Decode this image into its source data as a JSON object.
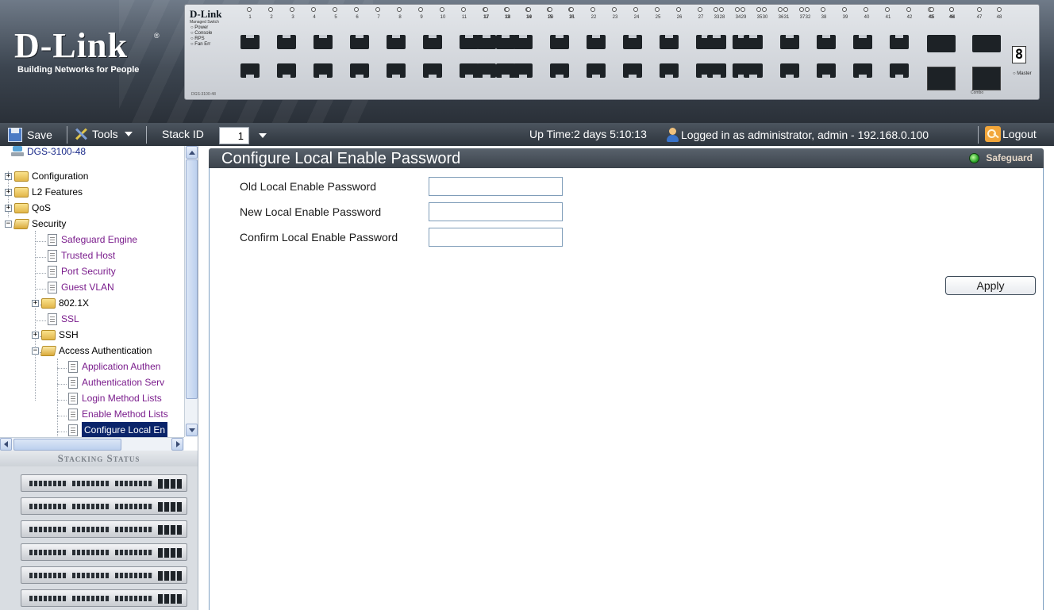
{
  "brand": {
    "logo": "D-Link",
    "tagline": "Building Networks for People"
  },
  "device_panel": {
    "brand": "D-Link",
    "subtitle": "Managed Switch",
    "model": "DGS-3100-48",
    "leds": [
      "Power",
      "Console",
      "RPS",
      "Fan Err"
    ],
    "port_numbers": [
      "1",
      "2",
      "3",
      "4",
      "5",
      "6",
      "7",
      "8",
      "9",
      "10",
      "11",
      "12",
      "13",
      "14",
      "15",
      "16",
      "17",
      "18",
      "19",
      "20",
      "21",
      "22",
      "23",
      "24",
      "25",
      "26",
      "27",
      "28",
      "29",
      "30",
      "31",
      "32",
      "33",
      "34",
      "35",
      "36",
      "37",
      "38",
      "39",
      "40",
      "41",
      "42",
      "43",
      "44",
      "45",
      "46",
      "47",
      "48"
    ],
    "combo_ports": [
      "45",
      "46",
      "47",
      "48"
    ],
    "combo_label": "Combo",
    "master_label": "Master",
    "unit_display": "8"
  },
  "toolbar": {
    "save_label": "Save",
    "tools_label": "Tools",
    "stack_id_label": "Stack ID",
    "stack_id_value": "1",
    "uptime": "Up Time:2 days 5:10:13",
    "login_status": "Logged in as administrator, admin - 192.168.0.100",
    "logout_label": "Logout"
  },
  "tree": {
    "root": "DGS-3100-48",
    "items": [
      {
        "label": "Configuration"
      },
      {
        "label": "L2 Features"
      },
      {
        "label": "QoS"
      },
      {
        "label": "Security"
      },
      {
        "label": "Safeguard Engine"
      },
      {
        "label": "Trusted Host"
      },
      {
        "label": "Port Security"
      },
      {
        "label": "Guest VLAN"
      },
      {
        "label": "802.1X"
      },
      {
        "label": "SSL"
      },
      {
        "label": "SSH"
      },
      {
        "label": "Access Authentication"
      },
      {
        "label": "Application Authen"
      },
      {
        "label": "Authentication Serv"
      },
      {
        "label": "Login Method Lists"
      },
      {
        "label": "Enable Method Lists"
      },
      {
        "label": "Configure Local En"
      }
    ]
  },
  "stacking": {
    "title": "Stacking Status",
    "unit_count": 6
  },
  "content": {
    "title": "Configure Local Enable Password",
    "safeguard_label": "Safeguard",
    "fields": [
      {
        "label": "Old Local Enable Password",
        "value": ""
      },
      {
        "label": "New Local Enable Password",
        "value": ""
      },
      {
        "label": "Confirm Local Enable Password",
        "value": ""
      }
    ],
    "apply_label": "Apply"
  },
  "colors": {
    "header_bg": "#3c4550",
    "title_bar_bg": "#4a525b",
    "tree_page_text": "#7a1c8c",
    "selected_bg": "#0a246a",
    "safeguard_led": "#2da52b"
  }
}
